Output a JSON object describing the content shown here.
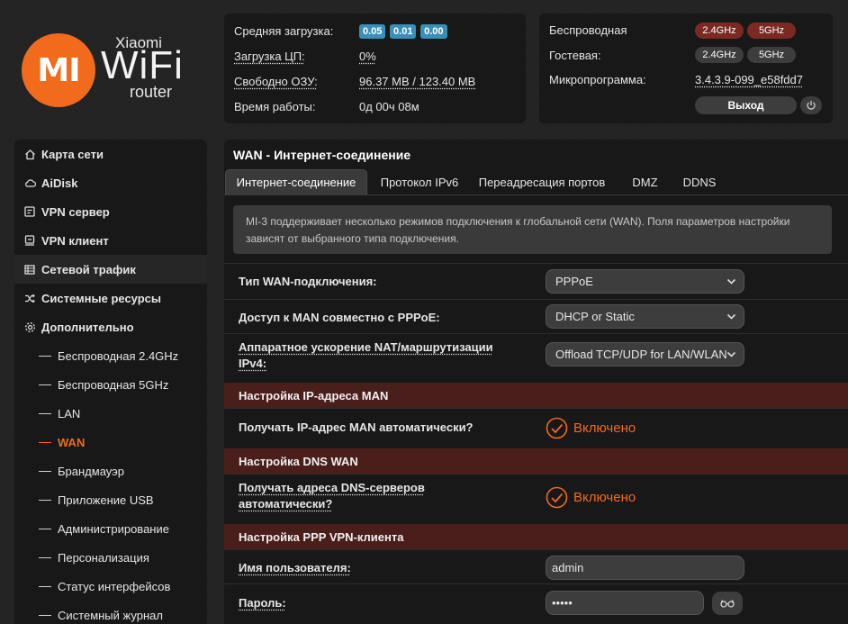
{
  "logo": {
    "mark": "MI",
    "brand_top": "Xiaomi",
    "brand_main": "WiFi",
    "brand_sub": "router"
  },
  "stats": {
    "load_label": "Средняя загрузка:",
    "load_values": [
      "0.05",
      "0.01",
      "0.00"
    ],
    "cpu_label": "Загрузка ЦП:",
    "cpu_value": "0%",
    "ram_label": "Свободно ОЗУ:",
    "ram_value": "96.37 MB / 123.40 MB",
    "uptime_label": "Время работы:",
    "uptime_value": "0д 00ч 08м"
  },
  "wireless": {
    "wireless_label": "Беспроводная",
    "guest_label": "Гостевая:",
    "firmware_label": "Микропрограмма:",
    "firmware_value": "3.4.3.9-099_e58fdd7",
    "band_24": "2.4GHz",
    "band_5": "5GHz",
    "logout_label": "Выход"
  },
  "sidebar": {
    "items": [
      {
        "label": "Карта сети",
        "icon": "home-icon"
      },
      {
        "label": "AiDisk",
        "icon": "cloud-icon"
      },
      {
        "label": "VPN сервер",
        "icon": "vpn-server-icon"
      },
      {
        "label": "VPN клиент",
        "icon": "vpn-client-icon"
      },
      {
        "label": "Сетевой трафик",
        "icon": "traffic-icon"
      },
      {
        "label": "Системные ресурсы",
        "icon": "shuffle-icon"
      },
      {
        "label": "Дополнительно",
        "icon": "gear-icon"
      }
    ],
    "subitems": [
      "Беспроводная 2.4GHz",
      "Беспроводная 5GHz",
      "LAN",
      "WAN",
      "Брандмауэр",
      "Приложение USB",
      "Администрирование",
      "Персонализация",
      "Статус интерфейсов",
      "Системный журнал"
    ]
  },
  "main": {
    "title": "WAN - Интернет-соединение",
    "tabs": [
      "Интернет-соединение",
      "Протокол IPv6",
      "Переадресация портов",
      "DMZ",
      "DDNS"
    ],
    "info": "MI-3 поддерживает несколько режимов подключения к глобальной сети (WAN). Поля параметров настройки зависят от выбранного типа подключения.",
    "wan_type_label": "Тип WAN-подключения:",
    "wan_type_value": "PPPoE",
    "man_access_label": "Доступ к MAN совместно с PPPoE:",
    "man_access_value": "DHCP or Static",
    "nat_label": "Аппаратное ускорение NAT/маршрутизации IPv4:",
    "nat_value": "Offload TCP/UDP for LAN/WLAN",
    "section_ip": "Настройка IP-адреса MAN",
    "auto_ip_label": "Получать IP-адрес MAN автоматически?",
    "enabled_label": "Включено",
    "section_dns": "Настройка DNS WAN",
    "auto_dns_label": "Получать адреса DNS-серверов автоматически?",
    "section_ppp": "Настройка PPP VPN-клиента",
    "username_label": "Имя пользователя:",
    "username_value": "admin",
    "password_label": "Пароль:",
    "password_value": "•••••"
  },
  "colors": {
    "accent": "#f26a1b",
    "section_bg": "#4a1e1b",
    "badge": "#3a8fb7"
  }
}
